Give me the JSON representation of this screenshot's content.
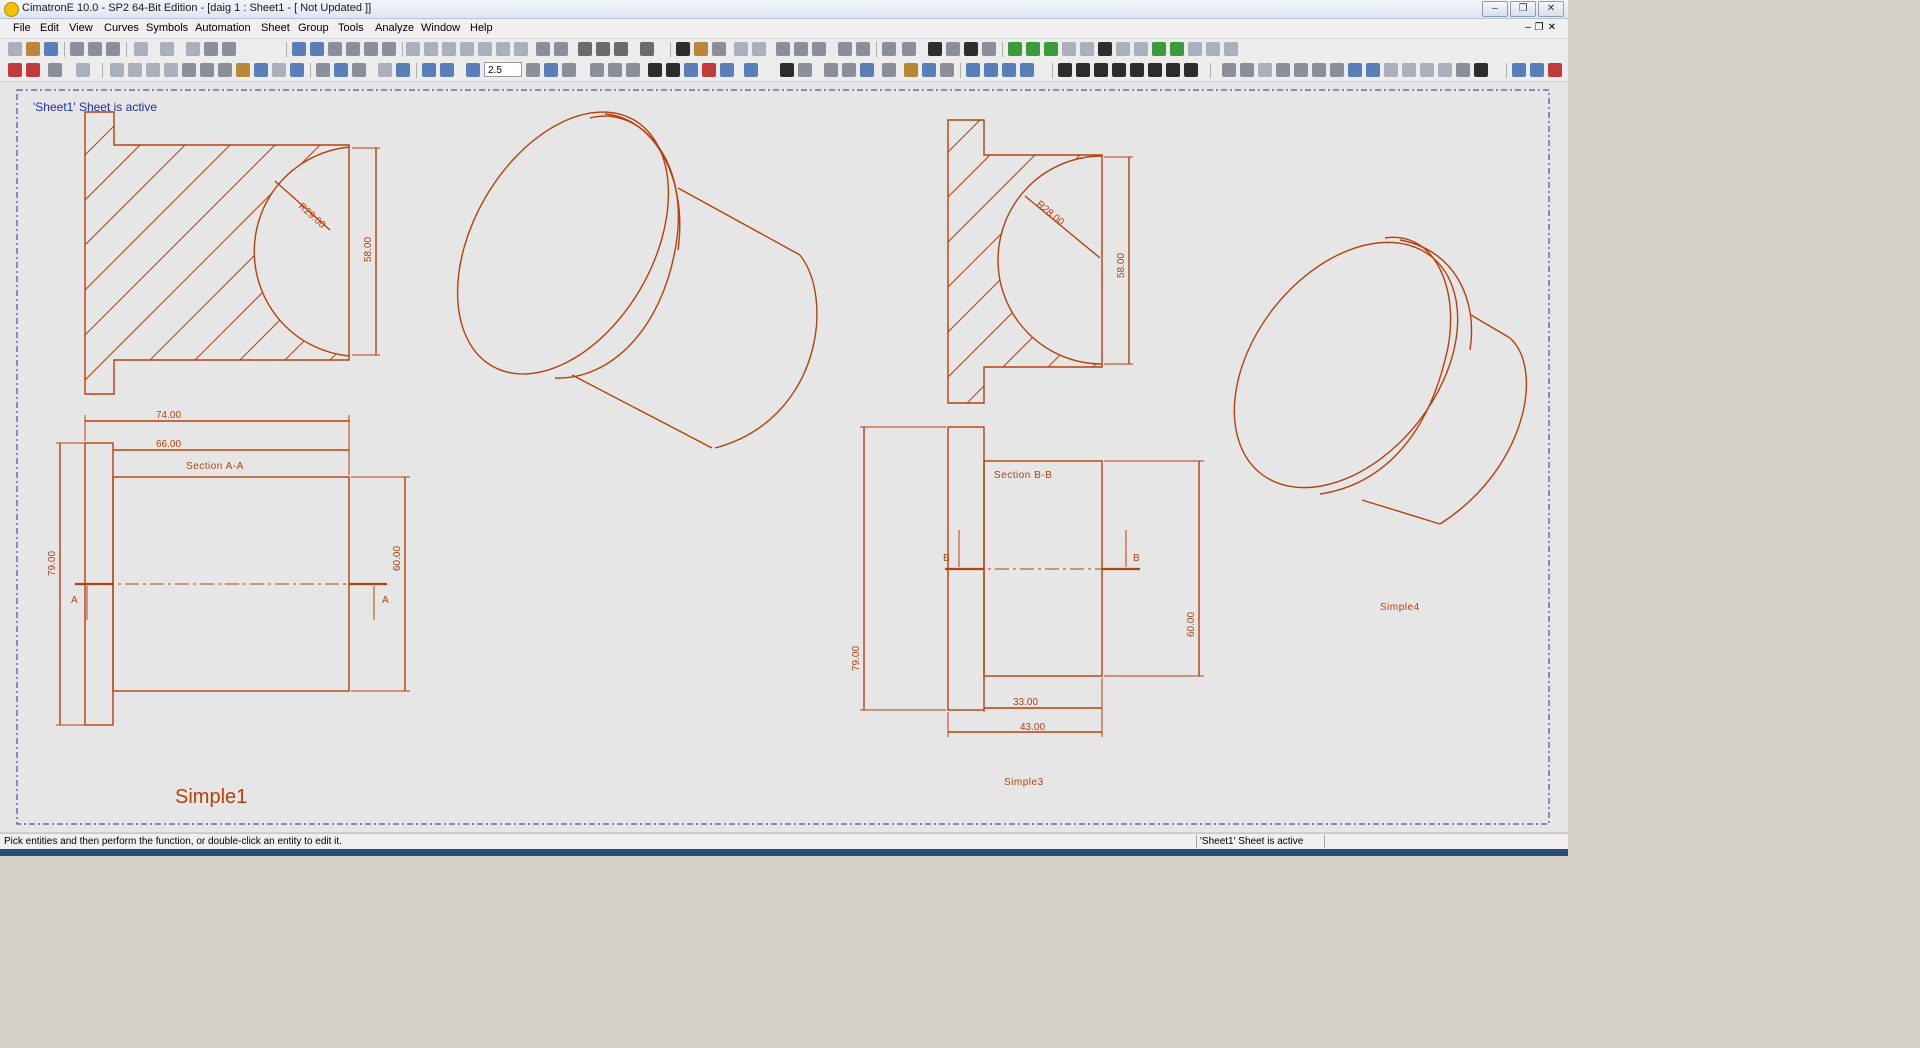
{
  "window": {
    "title": "CimatronE 10.0 - SP2 64-Bit Edition - [daig 1 : Sheet1 - [ Not Updated ]]"
  },
  "menu": {
    "items": [
      "File",
      "Edit",
      "View",
      "Curves",
      "Symbols",
      "Automation",
      "Sheet",
      "Group",
      "Tools",
      "Analyze",
      "Window",
      "Help"
    ]
  },
  "toolbar": {
    "scale_value": "2.5"
  },
  "canvas": {
    "active_sheet_msg": "'Sheet1' Sheet is active",
    "view1": {
      "radius_dim": "R29.00",
      "height_dim": "58.00",
      "overall_width": "74.00",
      "inner_width": "66.00",
      "section_label": "Section A-A",
      "height_left": "79.00",
      "height_right": "60.00",
      "cut_mark": "A",
      "name": "Simple1"
    },
    "view3": {
      "radius_dim": "R28.00",
      "height_dim": "58.00",
      "section_label": "Section B-B",
      "height_left": "79.00",
      "height_right": "60.00",
      "dim_inner": "33.00",
      "dim_outer": "43.00",
      "cut_mark": "B",
      "name": "Simple3"
    },
    "view4": {
      "name": "Simple4"
    }
  },
  "colors": {
    "drawing": "#b5410c",
    "sheet_border": "#1f2fa3",
    "canvas_bg": "#e6e6e6"
  },
  "status": {
    "hint": "Pick entities and then perform the function, or double-click an entity to edit it.",
    "sheet": "'Sheet1' Sheet is active"
  }
}
